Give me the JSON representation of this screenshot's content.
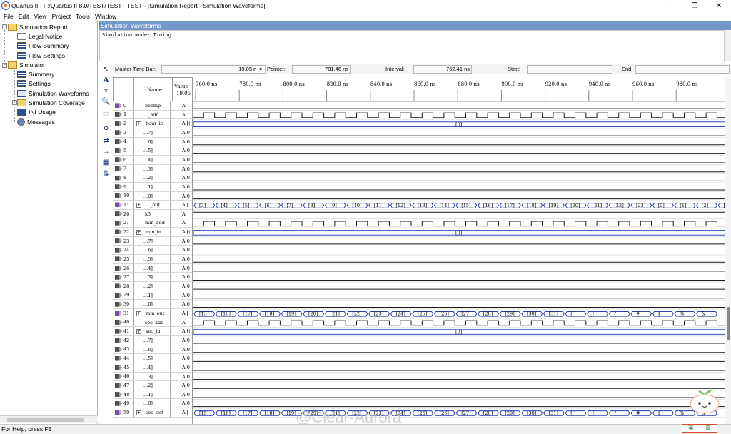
{
  "window": {
    "title": "Quartus II - F:/Quartus II 8.0/TEST/TEST - TEST - [Simulation Report - Simulation Waveforms]",
    "minimize": "–",
    "restore": "❐",
    "close": "✕"
  },
  "menu": [
    "File",
    "Edit",
    "View",
    "Project",
    "Tools",
    "Window"
  ],
  "tree": {
    "items": [
      {
        "label": "Simulation Report",
        "icon": "folder-icon"
      },
      {
        "label": "Legal Notice",
        "icon": "document-icon"
      },
      {
        "label": "Flow Summary",
        "icon": "table-icon"
      },
      {
        "label": "Flow Settings",
        "icon": "table-icon"
      },
      {
        "label": "Simulator",
        "icon": "folder-icon"
      },
      {
        "label": "Summary",
        "icon": "table-icon"
      },
      {
        "label": "Settings",
        "icon": "table-icon"
      },
      {
        "label": "Simulation Waveforms",
        "icon": "waveform-icon"
      },
      {
        "label": "Simulation Coverage",
        "icon": "folder-icon"
      },
      {
        "label": "INI Usage",
        "icon": "table-icon"
      },
      {
        "label": "Messages",
        "icon": "messages-icon"
      }
    ]
  },
  "report": {
    "header": "Simulation Waveforms",
    "mode_text": "Simulation mode: Timing"
  },
  "timebar": {
    "master_label": "Master Time Bar:",
    "master_value": "19.05 ns",
    "pointer_label": "Pointer:",
    "pointer_value": "781.46 ns",
    "interval_label": "Interval:",
    "interval_value": "762.41 ns",
    "start_label": "Start:",
    "start_value": "",
    "end_label": "End:",
    "end_value": ""
  },
  "columns": {
    "name": "Name",
    "value": "Value",
    "value_time": "19.05"
  },
  "time_ticks": [
    "760.0 ns",
    "780.0 ns",
    "800.0 ns",
    "820.0 ns",
    "840.0 ns",
    "860.0 ns",
    "880.0 ns",
    "900.0 ns",
    "920.0 ns",
    "940.0 ns",
    "960.0 ns",
    "980.0 ns"
  ],
  "signals": [
    {
      "id": "0",
      "name": "beemp",
      "value": "A",
      "kind": "out",
      "wave": "low"
    },
    {
      "id": "1",
      "name": "..._add",
      "value": "A",
      "kind": "in",
      "wave": "clock"
    },
    {
      "id": "2",
      "name": "hour_in",
      "value": "A [(",
      "kind": "in",
      "wave": "bus",
      "expand": true,
      "bus_label": "[0]"
    },
    {
      "id": "3",
      "name": "...7]",
      "value": "A 0",
      "kind": "in",
      "wave": "low"
    },
    {
      "id": "4",
      "name": "...6]",
      "value": "A 0",
      "kind": "in",
      "wave": "low"
    },
    {
      "id": "5",
      "name": "...5]",
      "value": "A 0",
      "kind": "in",
      "wave": "low"
    },
    {
      "id": "6",
      "name": "...4]",
      "value": "A 0",
      "kind": "in",
      "wave": "low"
    },
    {
      "id": "7",
      "name": "...3]",
      "value": "A 0",
      "kind": "in",
      "wave": "low"
    },
    {
      "id": "8",
      "name": "...2]",
      "value": "A 0",
      "kind": "in",
      "wave": "low"
    },
    {
      "id": "9",
      "name": "...1]",
      "value": "A 0",
      "kind": "in",
      "wave": "low"
    },
    {
      "id": "10",
      "name": "...0]",
      "value": "A 0",
      "kind": "in",
      "wave": "low"
    },
    {
      "id": "11",
      "name": "..._out",
      "value": "A [",
      "kind": "out",
      "wave": "counter",
      "expand": true,
      "counter": [
        "[3]",
        "[4]",
        "[5]",
        "[6]",
        "[7]",
        "[8]",
        "[9]",
        "[10]",
        "[11]",
        "[12]",
        "[13]",
        "[14]",
        "[15]",
        "[16]",
        "[17]",
        "[18]",
        "[19]",
        "[20]",
        "[21]",
        "[22]",
        "[23]",
        "[0]",
        "[1]",
        "[2]",
        "[3]"
      ]
    },
    {
      "id": "20",
      "name": "k3",
      "value": "A",
      "kind": "in",
      "wave": "high"
    },
    {
      "id": "21",
      "name": "min_add",
      "value": "A",
      "kind": "in",
      "wave": "clock"
    },
    {
      "id": "22",
      "name": "min_in",
      "value": "A [(",
      "kind": "in",
      "wave": "bus",
      "expand": true,
      "bus_label": "[0]"
    },
    {
      "id": "23",
      "name": "...7]",
      "value": "A 0",
      "kind": "in",
      "wave": "low"
    },
    {
      "id": "24",
      "name": "...6]",
      "value": "A 0",
      "kind": "in",
      "wave": "low"
    },
    {
      "id": "25",
      "name": "...5]",
      "value": "A 0",
      "kind": "in",
      "wave": "low"
    },
    {
      "id": "26",
      "name": "...4]",
      "value": "A 0",
      "kind": "in",
      "wave": "low"
    },
    {
      "id": "27",
      "name": "...3]",
      "value": "A 0",
      "kind": "in",
      "wave": "low"
    },
    {
      "id": "28",
      "name": "...2]",
      "value": "A 0",
      "kind": "in",
      "wave": "low"
    },
    {
      "id": "29",
      "name": "...1]",
      "value": "A 0",
      "kind": "in",
      "wave": "low"
    },
    {
      "id": "30",
      "name": "...0]",
      "value": "A 0",
      "kind": "in",
      "wave": "low"
    },
    {
      "id": "31",
      "name": "min_out",
      "value": "A [",
      "kind": "out",
      "wave": "counter",
      "expand": true,
      "counter": [
        "[15]",
        "[16]",
        "[17]",
        "[18]",
        "[19]",
        "[20]",
        "[21]",
        "[22]",
        "[23]",
        "[24]",
        "[25]",
        "[26]",
        "[27]",
        "[28]",
        "[29]",
        "[30]",
        "[31]",
        "[ ]",
        "!",
        "\"",
        "#",
        "$",
        "%",
        "&"
      ]
    },
    {
      "id": "40",
      "name": "sec_add",
      "value": "A",
      "kind": "in",
      "wave": "clock"
    },
    {
      "id": "41",
      "name": "sec_in",
      "value": "A [(",
      "kind": "in",
      "wave": "bus",
      "expand": true,
      "bus_label": "[0]"
    },
    {
      "id": "42",
      "name": "...7]",
      "value": "A 0",
      "kind": "in",
      "wave": "low"
    },
    {
      "id": "43",
      "name": "...6]",
      "value": "A 0",
      "kind": "in",
      "wave": "low"
    },
    {
      "id": "44",
      "name": "...5]",
      "value": "A 0",
      "kind": "in",
      "wave": "low"
    },
    {
      "id": "45",
      "name": "...4]",
      "value": "A 0",
      "kind": "in",
      "wave": "low"
    },
    {
      "id": "46",
      "name": "...3]",
      "value": "A 0",
      "kind": "in",
      "wave": "low"
    },
    {
      "id": "47",
      "name": "...2]",
      "value": "A 0",
      "kind": "in",
      "wave": "low"
    },
    {
      "id": "48",
      "name": "...1]",
      "value": "A 0",
      "kind": "in",
      "wave": "low"
    },
    {
      "id": "49",
      "name": "...0]",
      "value": "A 0",
      "kind": "in",
      "wave": "low"
    },
    {
      "id": "50",
      "name": "sec_out",
      "value": "A [",
      "kind": "out",
      "wave": "counter",
      "expand": true,
      "counter": [
        "[15]",
        "[16]",
        "[17]",
        "[18]",
        "[19]",
        "[20]",
        "[21]",
        "[22]",
        "[23]",
        "[24]",
        "[25]",
        "[26]",
        "[27]",
        "[28]",
        "[29]",
        "[30]",
        "[31]",
        "[ ]",
        "!",
        "\"",
        "#",
        "$",
        "%",
        "&"
      ]
    }
  ],
  "status": "For Help, press F1",
  "watermark": "@Clear-Aurora",
  "ime": [
    "英",
    "简"
  ],
  "colors": {
    "header_blue": "#7596c9",
    "wave": "#1a1a1a",
    "bus_line": "#2d4ec0",
    "bus_mark": "#2a3fb0"
  }
}
